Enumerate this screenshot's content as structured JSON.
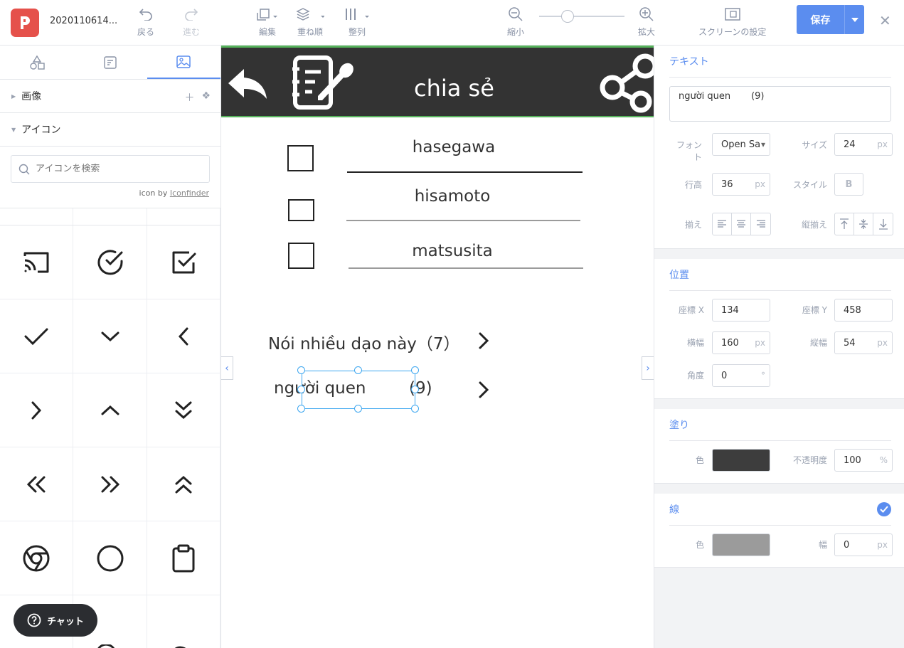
{
  "topbar": {
    "logo_letter": "P",
    "file_name": "2020110614...",
    "undo_label": "戻る",
    "redo_label": "進む",
    "edit_label": "編集",
    "order_label": "重ね順",
    "align_label": "整列",
    "zoom_out_label": "縮小",
    "zoom_in_label": "拡大",
    "screen_settings_label": "スクリーンの設定",
    "save_label": "保存"
  },
  "left_panel": {
    "tabs": [
      "shapes",
      "components",
      "images"
    ],
    "active_tab": "images",
    "sections": {
      "images_label": "画像",
      "icons_label": "アイコン"
    },
    "search": {
      "placeholder": "アイコンを検索",
      "value": ""
    },
    "credit_prefix": "icon by ",
    "credit_link": "Iconfinder",
    "icons": [
      "cast-icon",
      "check-circle-icon",
      "check-square-icon",
      "check-icon",
      "chevron-down-icon",
      "chevron-left-icon",
      "chevron-right-icon",
      "chevron-up-icon",
      "chevrons-down-icon",
      "chevrons-left-icon",
      "chevrons-right-icon",
      "chevrons-up-icon",
      "chrome-icon",
      "circle-icon",
      "clipboard-icon",
      "clock-icon",
      "cloud-drizzle-icon",
      "cloud-lightning-icon"
    ],
    "chat_label": "チャット"
  },
  "canvas": {
    "header_title": "chia sẻ",
    "header_color": "#333333",
    "accent_color": "#56b35b",
    "names": [
      "hasegawa",
      "hisamoto",
      "matsusita"
    ],
    "menu_rows": [
      {
        "label": "Nói nhiều dạo này（7）"
      },
      {
        "label": "người quen",
        "count": "(9)"
      }
    ]
  },
  "right_panel": {
    "text_section": {
      "title": "テキスト",
      "value": "người quen       (9)",
      "font_label": "フォント",
      "font_value": "Open Sa",
      "size_label": "サイズ",
      "size_value": "24",
      "line_height_label": "行高",
      "line_height_value": "36",
      "style_label": "スタイル",
      "style_bold": "B",
      "align_label": "揃え",
      "valign_label": "縦揃え",
      "unit_px": "px"
    },
    "position_section": {
      "title": "位置",
      "x_label": "座標 X",
      "x_value": "134",
      "y_label": "座標 Y",
      "y_value": "458",
      "w_label": "横幅",
      "w_value": "160",
      "h_label": "縦幅",
      "h_value": "54",
      "angle_label": "角度",
      "angle_value": "0",
      "angle_unit": "°"
    },
    "fill_section": {
      "title": "塗り",
      "color_label": "色",
      "color_value": "#3d3d3d",
      "opacity_label": "不透明度",
      "opacity_value": "100",
      "opacity_unit": "%"
    },
    "stroke_section": {
      "title": "線",
      "enabled": true,
      "color_label": "色",
      "color_value": "#9b9b9b",
      "width_label": "幅",
      "width_value": "0"
    }
  },
  "colors": {
    "primary": "#5b8def",
    "logo": "#e5514b",
    "selection": "#3ea7f0"
  }
}
